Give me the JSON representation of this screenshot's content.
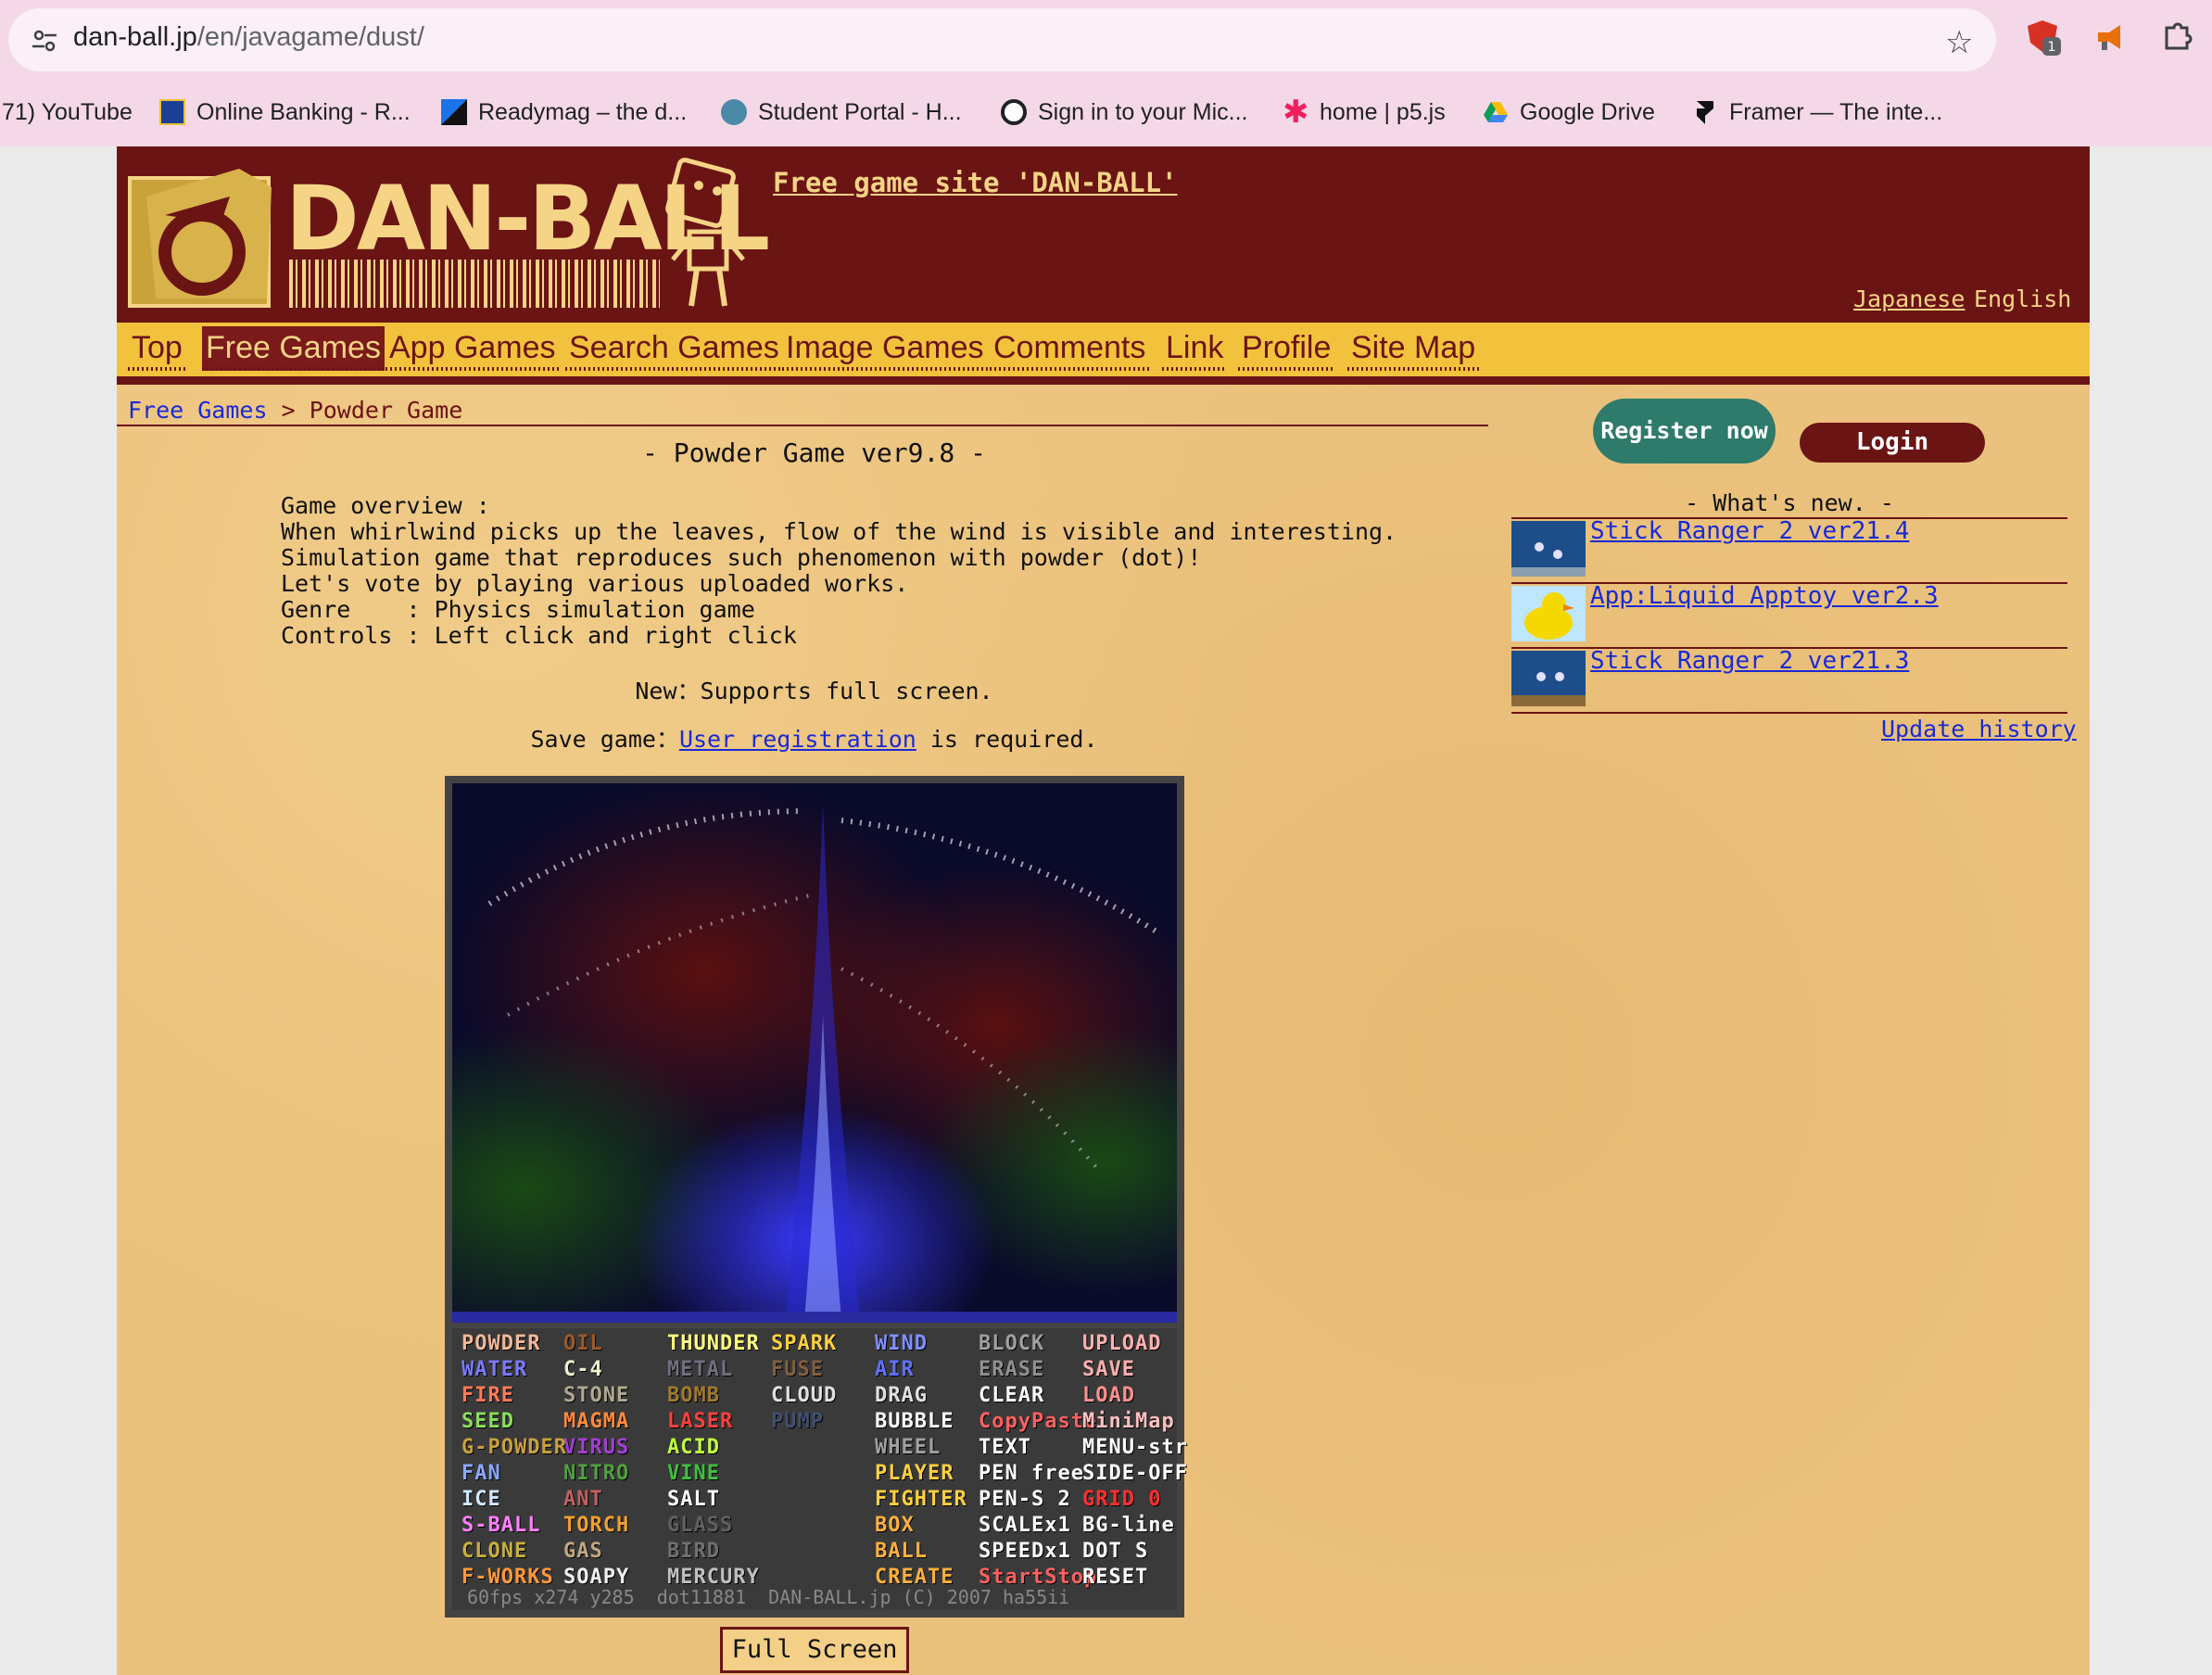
{
  "browser": {
    "url_host": "dan-ball.jp",
    "url_path": "/en/javagame/dust/",
    "bookmarks": [
      {
        "label": "71) YouTube",
        "icon": "youtube-icon"
      },
      {
        "label": "Online Banking - R...",
        "icon": "bank-icon"
      },
      {
        "label": "Readymag – the d...",
        "icon": "readymag-icon"
      },
      {
        "label": "Student Portal - H...",
        "icon": "portal-icon"
      },
      {
        "label": "Sign in to your Mic...",
        "icon": "github-icon"
      },
      {
        "label": "home | p5.js",
        "icon": "p5js-icon"
      },
      {
        "label": "Google Drive",
        "icon": "google-drive-icon"
      },
      {
        "label": "Framer — The inte...",
        "icon": "framer-icon"
      }
    ],
    "extension_badge": "1"
  },
  "header": {
    "logo_text": "DAN-BALL",
    "site_link": "Free game site 'DAN-BALL'",
    "lang_japanese": "Japanese",
    "lang_english": "English"
  },
  "nav": [
    "Top",
    "Free Games",
    "App Games",
    "Search Games",
    "Image Games",
    "Comments",
    "Link",
    "Profile",
    "Site Map"
  ],
  "breadcrumb": {
    "parent": "Free Games",
    "sep": ">",
    "current": "Powder Game"
  },
  "main": {
    "title": "- Powder Game ver9.8 -",
    "overview": "Game overview :\nWhen whirlwind picks up the leaves, flow of the wind is visible and interesting.\nSimulation game that reproduces such phenomenon with powder (dot)!\nLet's vote by playing various uploaded works.\nGenre    : Physics simulation game\nControls : Left click and right click",
    "news_prefix": "New：",
    "news_text": "Supports full screen.",
    "save_prefix": "Save game：",
    "save_link": "User registration",
    "save_suffix": " is required.",
    "fullscreen_label": "Full Screen"
  },
  "game_menu": {
    "col1": [
      {
        "t": "POWDER",
        "c": "#f0b898"
      },
      {
        "t": "WATER",
        "c": "#7a7aff"
      },
      {
        "t": "FIRE",
        "c": "#ff7a5a"
      },
      {
        "t": "SEED",
        "c": "#8adf5a"
      },
      {
        "t": "G-POWDER",
        "c": "#c8a040"
      },
      {
        "t": "FAN",
        "c": "#8aa8ff"
      },
      {
        "t": "ICE",
        "c": "#d0e8ff"
      },
      {
        "t": "S-BALL",
        "c": "#ff80ff"
      },
      {
        "t": "CLONE",
        "c": "#c8b040"
      },
      {
        "t": "F-WORKS",
        "c": "#ff9a3a"
      }
    ],
    "col2": [
      {
        "t": "OIL",
        "c": "#9a5a2a"
      },
      {
        "t": "C-4",
        "c": "#f0f0d0"
      },
      {
        "t": "STONE",
        "c": "#b0a890"
      },
      {
        "t": "MAGMA",
        "c": "#ff8a3a"
      },
      {
        "t": "VIRUS",
        "c": "#a040d0"
      },
      {
        "t": "NITRO",
        "c": "#50a040"
      },
      {
        "t": "ANT",
        "c": "#c06060"
      },
      {
        "t": "TORCH",
        "c": "#f0a030"
      },
      {
        "t": "GAS",
        "c": "#c0a880"
      },
      {
        "t": "SOAPY",
        "c": "#f0f0f0"
      }
    ],
    "col3": [
      {
        "t": "THUNDER",
        "c": "#ffff80"
      },
      {
        "t": "METAL",
        "c": "#707080"
      },
      {
        "t": "BOMB",
        "c": "#a07a30"
      },
      {
        "t": "LASER",
        "c": "#ff4040"
      },
      {
        "t": "ACID",
        "c": "#c0ff40"
      },
      {
        "t": "VINE",
        "c": "#40c040"
      },
      {
        "t": "SALT",
        "c": "#ffffff"
      },
      {
        "t": "GLASS",
        "c": "#606060"
      },
      {
        "t": "BIRD",
        "c": "#707070"
      },
      {
        "t": "MERCURY",
        "c": "#c0c0c0"
      }
    ],
    "col4": [
      {
        "t": "SPARK",
        "c": "#ffd040"
      },
      {
        "t": "FUSE",
        "c": "#806040"
      },
      {
        "t": "CLOUD",
        "c": "#e0e0e0"
      },
      {
        "t": "PUMP",
        "c": "#405070"
      }
    ],
    "col5": [
      {
        "t": "WIND",
        "c": "#8090ff"
      },
      {
        "t": "AIR",
        "c": "#6070ff"
      },
      {
        "t": "DRAG",
        "c": "#e0e0e0"
      },
      {
        "t": "BUBBLE",
        "c": "#ffffff"
      },
      {
        "t": "WHEEL",
        "c": "#a0a0a0"
      },
      {
        "t": "PLAYER",
        "c": "#ffd040"
      },
      {
        "t": "FIGHTER",
        "c": "#ffd040"
      },
      {
        "t": "BOX",
        "c": "#ffb040"
      },
      {
        "t": "BALL",
        "c": "#ffb040"
      },
      {
        "t": "CREATE",
        "c": "#ffb040"
      }
    ],
    "col6": [
      {
        "t": "BLOCK",
        "c": "#a0a0a0"
      },
      {
        "t": "ERASE",
        "c": "#909090"
      },
      {
        "t": "CLEAR",
        "c": "#ffffff"
      },
      {
        "t": "CopyPaste",
        "c": "#ff6060"
      },
      {
        "t": "TEXT",
        "c": "#ffffff"
      },
      {
        "t": "PEN free",
        "c": "#ffffff"
      },
      {
        "t": "PEN-S 2",
        "c": "#ffffff"
      },
      {
        "t": "SCALEx1",
        "c": "#ffffff"
      },
      {
        "t": "SPEEDx1",
        "c": "#ffffff"
      },
      {
        "t": "StartStop",
        "c": "#ff6060"
      }
    ],
    "col7": [
      {
        "t": "UPLOAD",
        "c": "#ffb0b0"
      },
      {
        "t": "SAVE",
        "c": "#ffb0b0"
      },
      {
        "t": "LOAD",
        "c": "#ff9090"
      },
      {
        "t": "MiniMap",
        "c": "#ffc0c0"
      },
      {
        "t": "MENU-str",
        "c": "#ffffff"
      },
      {
        "t": "SIDE-OFF",
        "c": "#ffffff"
      },
      {
        "t": "GRID 0",
        "c": "#ff3030"
      },
      {
        "t": "BG-line",
        "c": "#ffffff"
      },
      {
        "t": "DOT S",
        "c": "#ffffff"
      },
      {
        "t": "RESET",
        "c": "#ffffff"
      }
    ],
    "status": "60fps x274 y285  dot11881  DAN-BALL.jp (C) 2007 ha55ii"
  },
  "sidebar": {
    "register_label": "Register now",
    "login_label": "Login",
    "whats_new_title": "- What's new. -",
    "news": [
      {
        "label": "Stick Ranger 2 ver21.4",
        "thumb": "stick-ranger-thumb"
      },
      {
        "label": "App:Liquid Apptoy ver2.3",
        "thumb": "duck-thumb"
      },
      {
        "label": "Stick Ranger 2 ver21.3",
        "thumb": "stick-ranger-thumb"
      }
    ],
    "update_history": "Update history"
  },
  "colors": {
    "brand_dark": "#6b1414",
    "brand_gold": "#f5d486",
    "nav_bg": "#f2c23c",
    "link": "#1a2ad6",
    "register": "#2e7a6b"
  }
}
